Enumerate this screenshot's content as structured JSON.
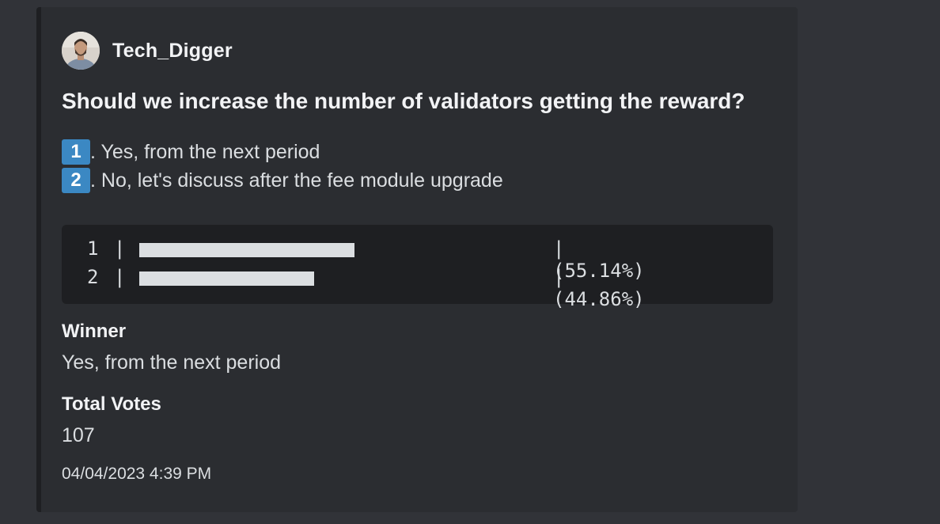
{
  "embed": {
    "author": {
      "name": "Tech_Digger"
    },
    "title": "Should we increase the number of validators getting the reward?",
    "options": [
      {
        "number": "1",
        "text": ". Yes, from the next period"
      },
      {
        "number": "2",
        "text": ". No, let's discuss after the fee module upgrade"
      }
    ],
    "results": [
      {
        "index": "1",
        "pipe": "|",
        "percent_text": "| (55.14%)",
        "share": 0.5514
      },
      {
        "index": "2",
        "pipe": "|",
        "percent_text": "| (44.86%)",
        "share": 0.4486
      }
    ],
    "winner": {
      "label": "Winner",
      "value": "Yes, from the next period"
    },
    "total_votes": {
      "label": "Total Votes",
      "value": "107"
    },
    "timestamp": "04/04/2023 4:39 PM"
  },
  "colors": {
    "background": "#313338",
    "embed_background": "#2b2d31",
    "embed_border": "#1e1f22",
    "code_background": "#1e1f22",
    "keycap": "#3b88c3",
    "text_primary": "#f2f3f5",
    "text_secondary": "#dbdee1"
  },
  "icons": {
    "avatar": "user-avatar-photo",
    "keycap_1": "keycap-digit-one",
    "keycap_2": "keycap-digit-two"
  }
}
